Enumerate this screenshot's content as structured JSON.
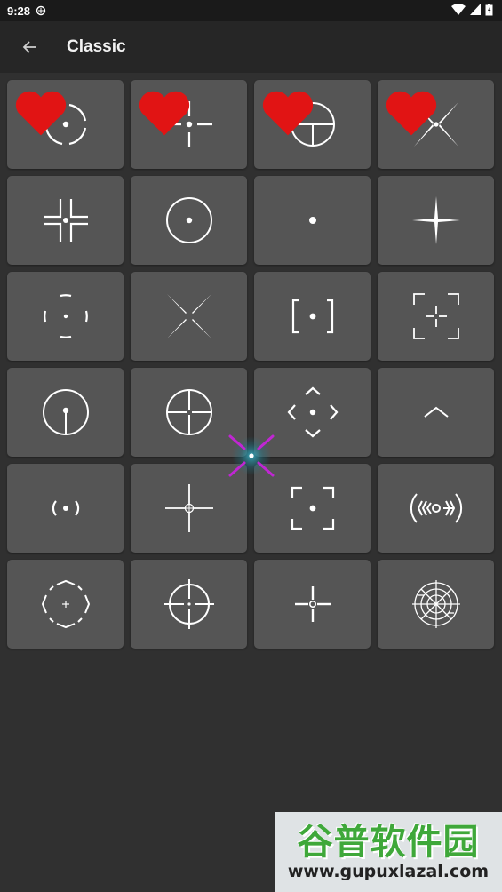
{
  "status_bar": {
    "time": "9:28"
  },
  "app_bar": {
    "title": "Classic"
  },
  "crosshairs": [
    {
      "icon": "circle-arcs-dot-crosshair-icon",
      "favorite": true
    },
    {
      "icon": "plus-gap-dot-crosshair-icon",
      "favorite": true
    },
    {
      "icon": "circle-t-crosshair-icon",
      "favorite": true
    },
    {
      "icon": "x-tapered-crosshair-icon",
      "favorite": true
    },
    {
      "icon": "corner-brackets-dot-crosshair-icon",
      "favorite": false
    },
    {
      "icon": "circle-dot-crosshair-icon",
      "favorite": false
    },
    {
      "icon": "dot-crosshair-icon",
      "favorite": false
    },
    {
      "icon": "star-crosshair-icon",
      "favorite": false
    },
    {
      "icon": "arcs-dot-crosshair-icon",
      "favorite": false
    },
    {
      "icon": "x-gap-crosshair-icon",
      "favorite": false
    },
    {
      "icon": "square-brackets-dot-crosshair-icon",
      "favorite": false
    },
    {
      "icon": "frame-corners-plus-crosshair-icon",
      "favorite": false
    },
    {
      "icon": "circle-tick-dot-crosshair-icon",
      "favorite": false
    },
    {
      "icon": "circle-cross-crosshair-icon",
      "favorite": false
    },
    {
      "icon": "diamond-chevrons-dot-crosshair-icon",
      "favorite": false
    },
    {
      "icon": "chevron-up-crosshair-icon",
      "favorite": false
    },
    {
      "icon": "parens-dot-crosshair-icon",
      "favorite": false
    },
    {
      "icon": "plus-small-circle-crosshair-icon",
      "favorite": false
    },
    {
      "icon": "frame-corners-dot-crosshair-icon",
      "favorite": false
    },
    {
      "icon": "rangefinder-crosshair-icon",
      "favorite": false
    },
    {
      "icon": "octagon-plus-crosshair-icon",
      "favorite": false
    },
    {
      "icon": "scope-circle-crosshair-icon",
      "favorite": false
    },
    {
      "icon": "plus-ring-crosshair-icon",
      "favorite": false
    },
    {
      "icon": "target-web-crosshair-icon",
      "favorite": false
    }
  ],
  "watermark": {
    "text": "谷普软件园",
    "url": "www.gupuxlazal.com"
  },
  "colors": {
    "favorite": "#e11414",
    "card": "#555555",
    "background": "#303030",
    "overlay_accent": "#c026d3"
  }
}
